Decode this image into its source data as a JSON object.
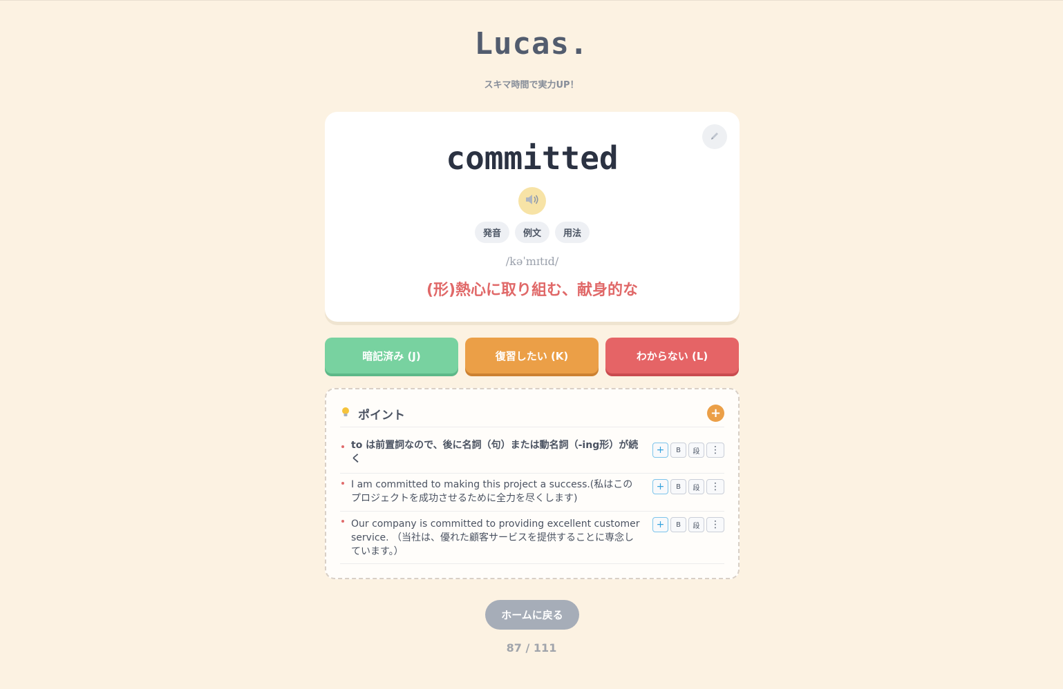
{
  "brand": "Lucas.",
  "tagline": "スキマ時間で実力UP！",
  "card": {
    "word": "committed",
    "audio_icon": "speaker-icon",
    "edit_icon": "pencil-icon",
    "chips": [
      "発音",
      "例文",
      "用法"
    ],
    "phonetic": "/kəˈmɪtɪd/",
    "meaning": "(形)熱心に取り組む、献身的な"
  },
  "actions": {
    "memorized": "暗記済み (J)",
    "review": "復習したい (K)",
    "unknown": "わからない (L)"
  },
  "points": {
    "icon": "lightbulb-icon",
    "title": "ポイント",
    "add_label": "+",
    "tools": {
      "plus": "+",
      "bold": "B",
      "paragraph": "段",
      "more": "⋮"
    },
    "items": [
      {
        "text": "to は前置詞なので、後に名詞（句）または動名詞（-ing形）が続く",
        "bold": true
      },
      {
        "text": "I am committed to making this project a success.(私はこのプロジェクトを成功させるために全力を尽くします)",
        "bold": false
      },
      {
        "text": "Our company is committed to providing excellent customer service. （当社は、優れた顧客サービスを提供することに専念しています。）",
        "bold": false
      }
    ]
  },
  "home_button": "ホームに戻る",
  "progress": "87 / 111",
  "colors": {
    "background": "#fcf2e2",
    "memorized": "#78d2a0",
    "review": "#eb9f47",
    "unknown": "#e56466",
    "meaning": "#e06868"
  }
}
